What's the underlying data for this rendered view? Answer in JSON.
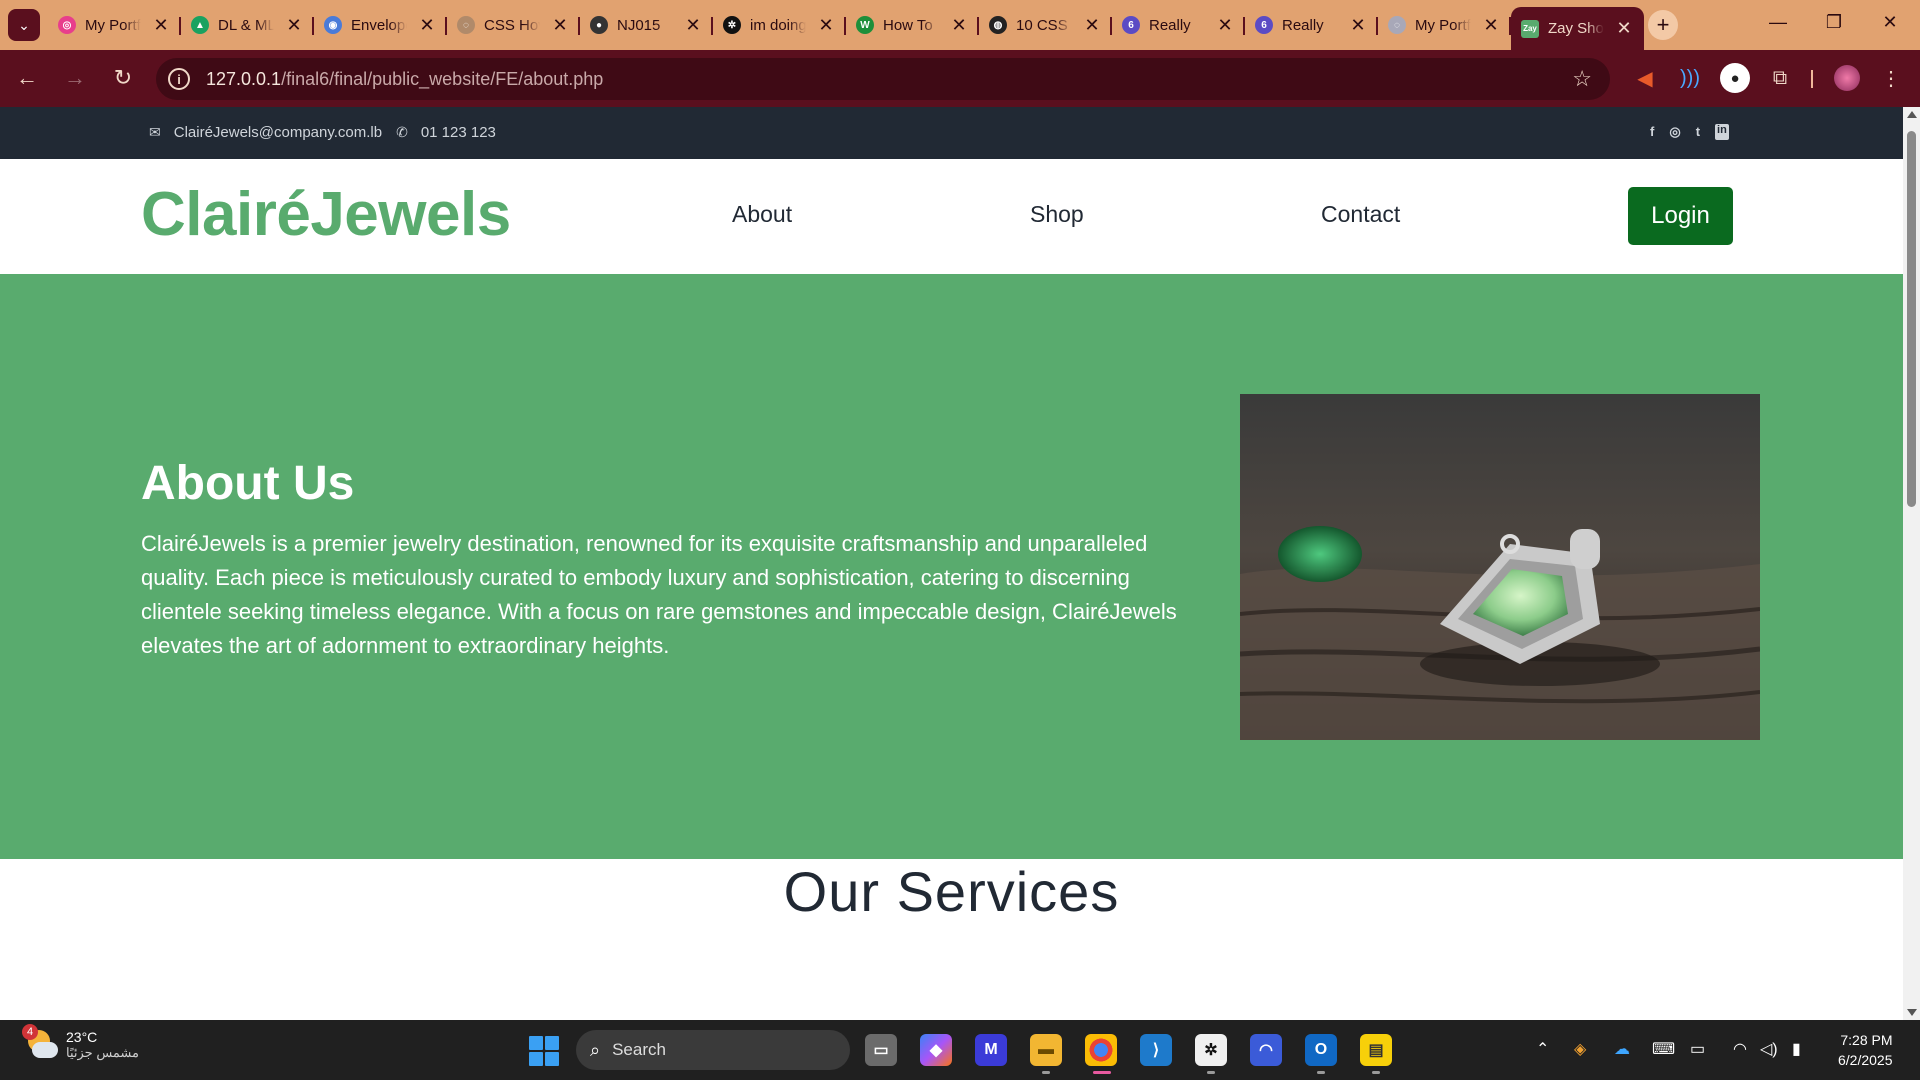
{
  "browser": {
    "tabs": [
      {
        "title": "My Portfolio",
        "favicon_color": "#e83e8c",
        "favicon_glyph": "◎"
      },
      {
        "title": "DL & ML",
        "favicon_color": "#1aa260",
        "favicon_glyph": "▲"
      },
      {
        "title": "Envelope",
        "favicon_color": "#4a7bd8",
        "favicon_glyph": "◉"
      },
      {
        "title": "CSS Hover",
        "favicon_color": "#b08a6a",
        "favicon_glyph": "◌"
      },
      {
        "title": "NJ015",
        "favicon_color": "#333333",
        "favicon_glyph": "●"
      },
      {
        "title": "im doing",
        "favicon_color": "#111111",
        "favicon_glyph": "✲"
      },
      {
        "title": "How To",
        "favicon_color": "#1d8f3a",
        "favicon_glyph": "W"
      },
      {
        "title": "10 CSS",
        "favicon_color": "#222222",
        "favicon_glyph": "◍"
      },
      {
        "title": "Really",
        "favicon_color": "#5b4bc4",
        "favicon_glyph": "6"
      },
      {
        "title": "Really",
        "favicon_color": "#5b4bc4",
        "favicon_glyph": "6"
      },
      {
        "title": "My Portfolio",
        "favicon_color": "#a8a8b8",
        "favicon_glyph": "◌"
      },
      {
        "title": "Zay Shop",
        "favicon_color": "#59ab6e",
        "favicon_glyph": "Zay",
        "active": true
      }
    ],
    "url_host": "127.0.0.1",
    "url_path": "/final6/final/public_website/FE/about.php"
  },
  "site": {
    "email": "ClairéJewels@company.com.lb",
    "phone": "01 123 123",
    "brand": "ClairéJewels",
    "nav": {
      "about": "About",
      "shop": "Shop",
      "contact": "Contact"
    },
    "login_label": "Login",
    "hero": {
      "title": "About Us",
      "body": "ClairéJewels is a premier jewelry destination, renowned for its exquisite craftsmanship and unparalleled quality. Each piece is meticulously curated to embody luxury and sophistication, catering to discerning clientele seeking timeless elegance. With a focus on rare gemstones and impeccable design, ClairéJewels elevates the art of adornment to extraordinary heights."
    },
    "services_heading": "Our Services",
    "socials": [
      "f",
      "◎",
      "t",
      "in"
    ],
    "colors": {
      "brand_green": "#59ab6e",
      "login_green": "#0a6a1f",
      "topbar_dark": "#212934"
    }
  },
  "taskbar": {
    "weather_temp": "23°C",
    "weather_desc": "مشمس جزئيًا",
    "weather_badge": "4",
    "search_placeholder": "Search",
    "time": "7:28 PM",
    "date": "6/2/2025"
  }
}
